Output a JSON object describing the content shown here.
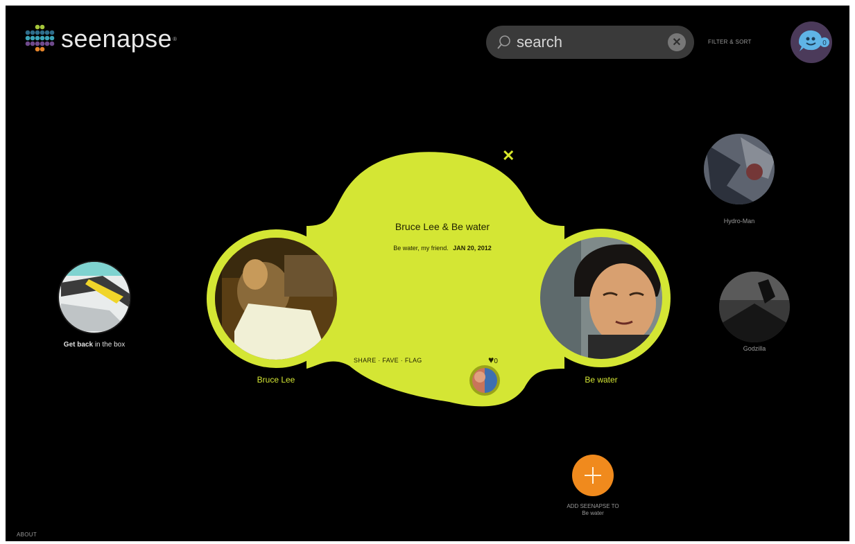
{
  "app": {
    "name": "seenapse",
    "trademark": "®"
  },
  "header": {
    "search": {
      "value": "search",
      "placeholder": "search"
    },
    "filter_label": "FILTER & SORT"
  },
  "seenapse": {
    "title": "Bruce Lee & Be water",
    "description": "Be water, my friend.",
    "date": "JAN 20, 2012",
    "actions": "SHARE · FAVE · FLAG",
    "fave_count": "0",
    "left_node": "Bruce Lee",
    "right_node": "Be water"
  },
  "side_nodes": {
    "left": {
      "label_bold": "Get back",
      "label_rest": "in the box"
    },
    "right_top": {
      "label": "Hydro-Man"
    },
    "right_bottom": {
      "label": "Godzilla"
    }
  },
  "add": {
    "caption_line1": "ADD SEENAPSE TO",
    "caption_line2": "Be water"
  },
  "footer": {
    "about": "ABOUT"
  },
  "colors": {
    "accent": "#d4e634",
    "add": "#f08a1d",
    "background": "#000000"
  },
  "icons": [
    "logo-dots-icon",
    "search-icon",
    "clear-icon",
    "chat-avatar-icon",
    "close-icon",
    "heart-icon",
    "plus-icon"
  ]
}
